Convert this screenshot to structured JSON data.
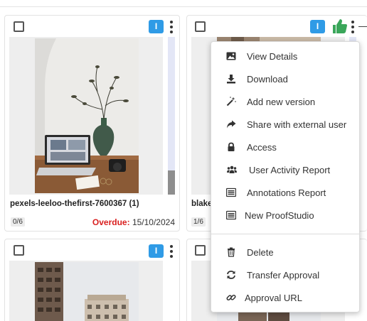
{
  "cards": [
    {
      "title": "pexels-leeloo-thefirst-7600367 (1)",
      "badge": "I",
      "count": "0/6",
      "due_label": "Overdue:",
      "due_date": "15/10/2024"
    },
    {
      "title": "blake",
      "badge": "I",
      "count": "1/6"
    },
    {
      "badge": "I"
    },
    {}
  ],
  "menu": {
    "items": [
      {
        "label": "View Details",
        "icon": "image-icon"
      },
      {
        "label": "Download",
        "icon": "download-icon"
      },
      {
        "label": "Add new version",
        "icon": "magic-wand-icon"
      },
      {
        "label": "Share with external user",
        "icon": "share-arrow-icon"
      },
      {
        "label": "Access",
        "icon": "lock-icon"
      },
      {
        "label": "User Activity Report",
        "icon": "users-icon"
      },
      {
        "label": "Annotations Report",
        "icon": "list-report-icon"
      },
      {
        "label": "New ProofStudio",
        "icon": "list-report-icon"
      },
      {
        "label": "Delete",
        "icon": "trash-icon"
      },
      {
        "label": "Transfer Approval",
        "icon": "sync-icon"
      },
      {
        "label": "Approval URL",
        "icon": "link-icon"
      }
    ]
  },
  "colors": {
    "badge_blue": "#2f9be6",
    "approve_green": "#3aa65a",
    "overdue_red": "#d92020"
  }
}
